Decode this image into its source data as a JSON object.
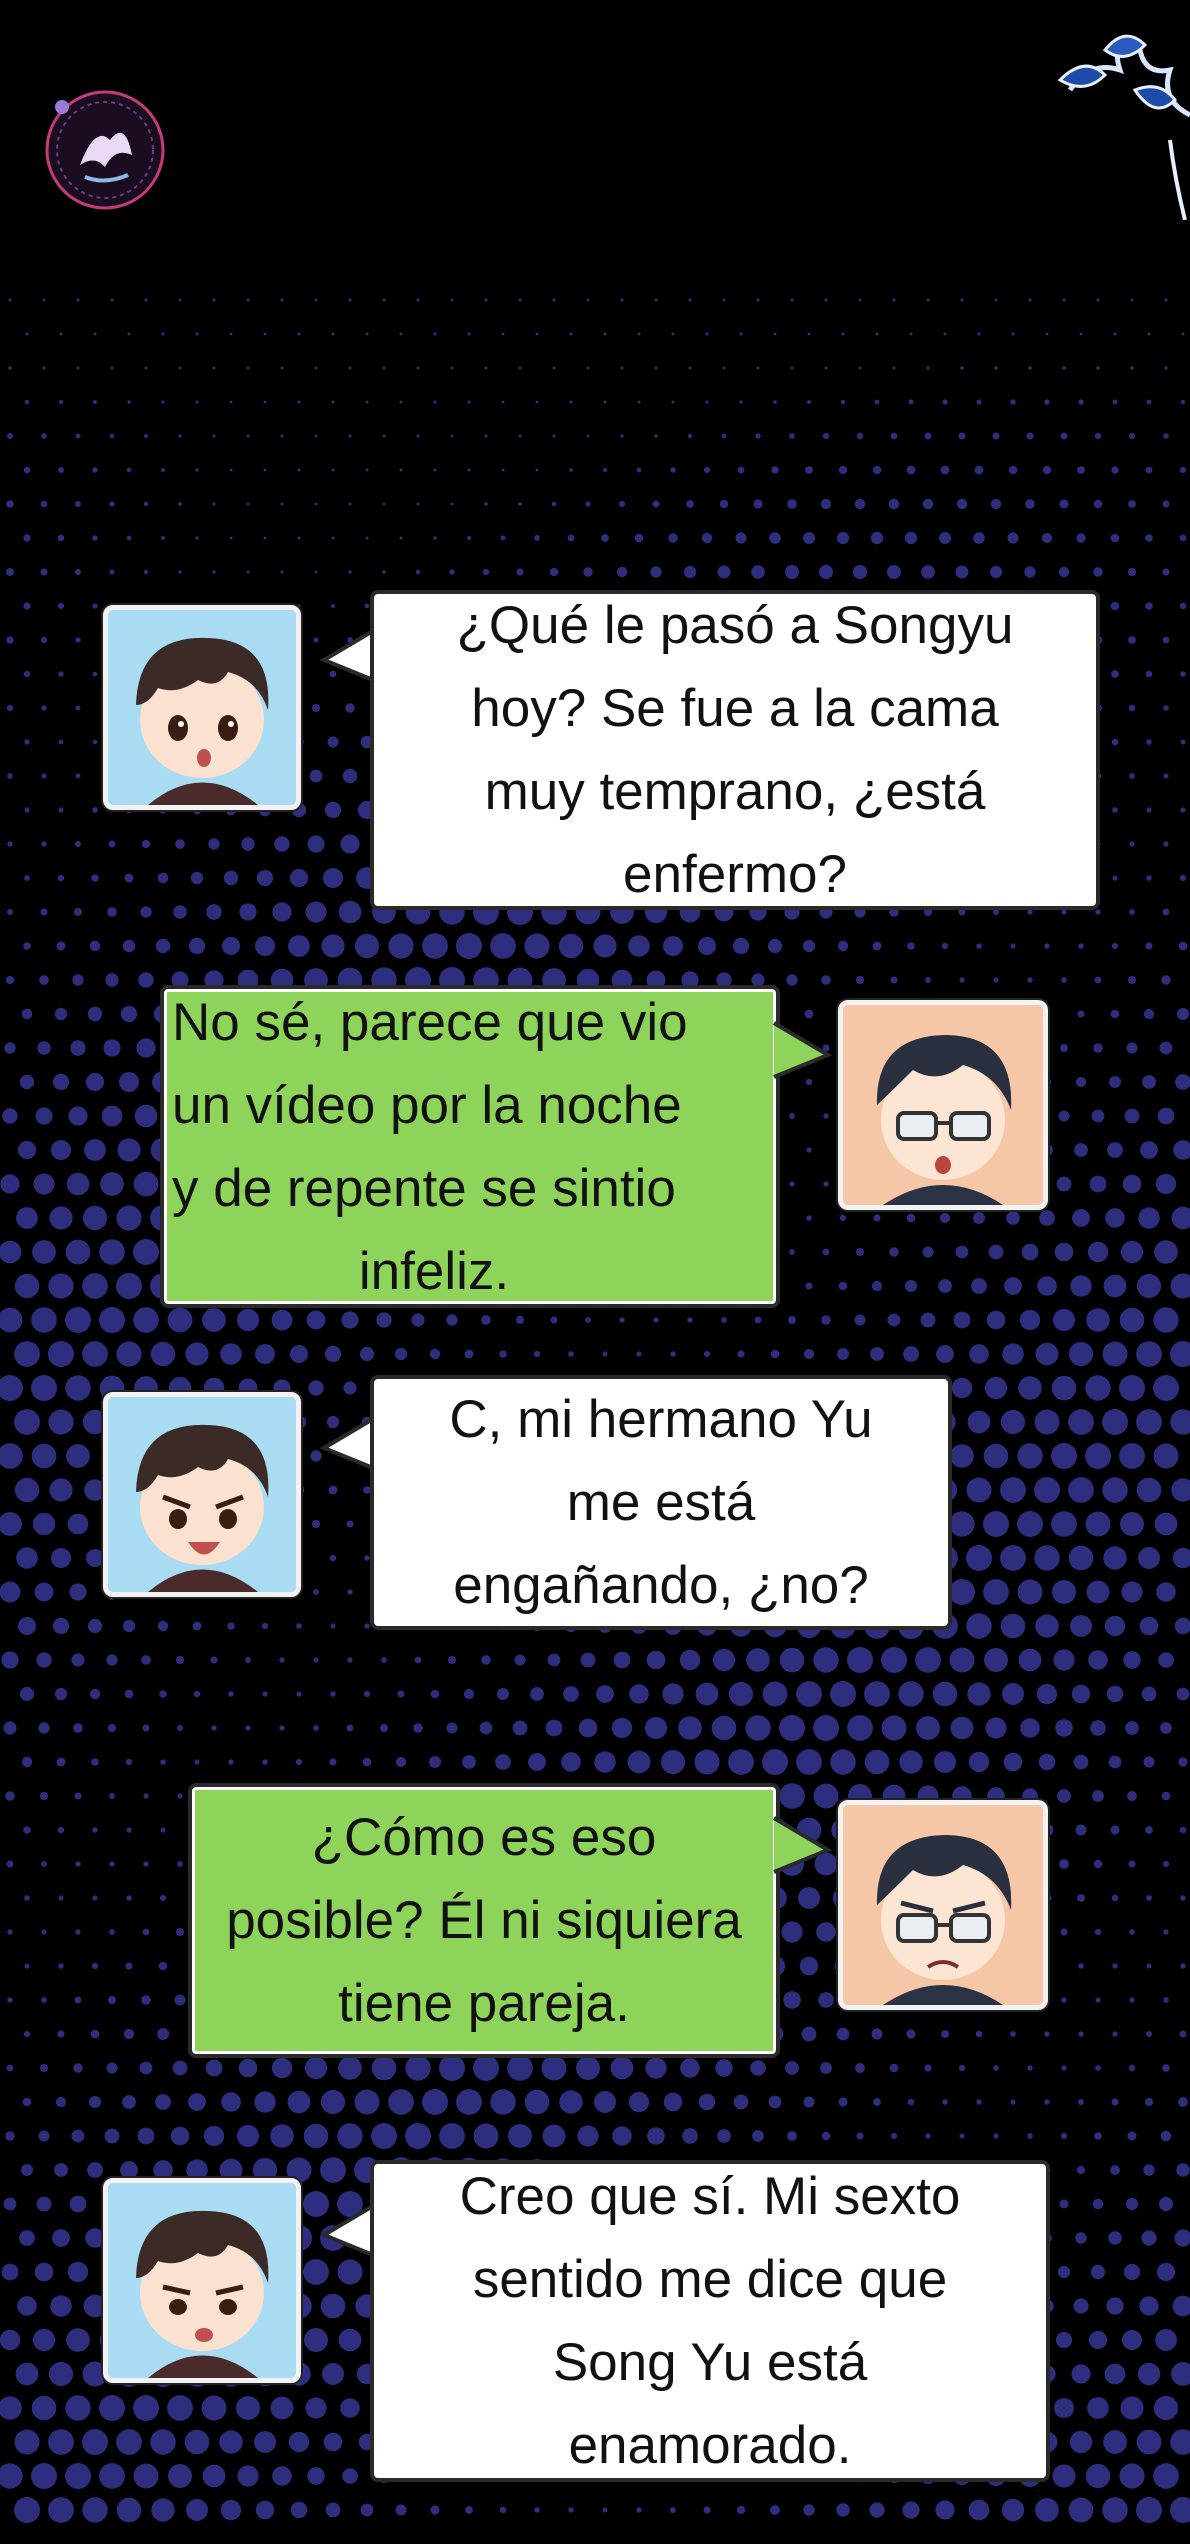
{
  "colors": {
    "background": "#000000",
    "dot_pattern": "#2e2e7e",
    "bubble_white": "#ffffff",
    "bubble_green": "#8fd45a",
    "bubble_border": "#2a2a2a"
  },
  "messages": [
    {
      "speaker": "boy",
      "style": "white",
      "lines": [
        "¿Qué le pasó a Songyu",
        "hoy? Se fue a la cama",
        "muy temprano, ¿está",
        "enfermo?"
      ]
    },
    {
      "speaker": "glasses",
      "style": "green",
      "lines": [
        "No sé, parece que vio",
        "un vídeo por la noche",
        "y de repente se sintio",
        "infeliz."
      ]
    },
    {
      "speaker": "boy",
      "style": "white",
      "lines": [
        "C, mi hermano Yu",
        "me está",
        "engañando, ¿no?"
      ]
    },
    {
      "speaker": "glasses",
      "style": "green",
      "lines": [
        "¿Cómo es eso",
        "posible? Él ni siquiera",
        "tiene pareja."
      ]
    },
    {
      "speaker": "boy",
      "style": "white",
      "lines": [
        "Creo que sí. Mi sexto",
        "sentido me dice que",
        "Song Yu está",
        "enamorado."
      ]
    }
  ]
}
